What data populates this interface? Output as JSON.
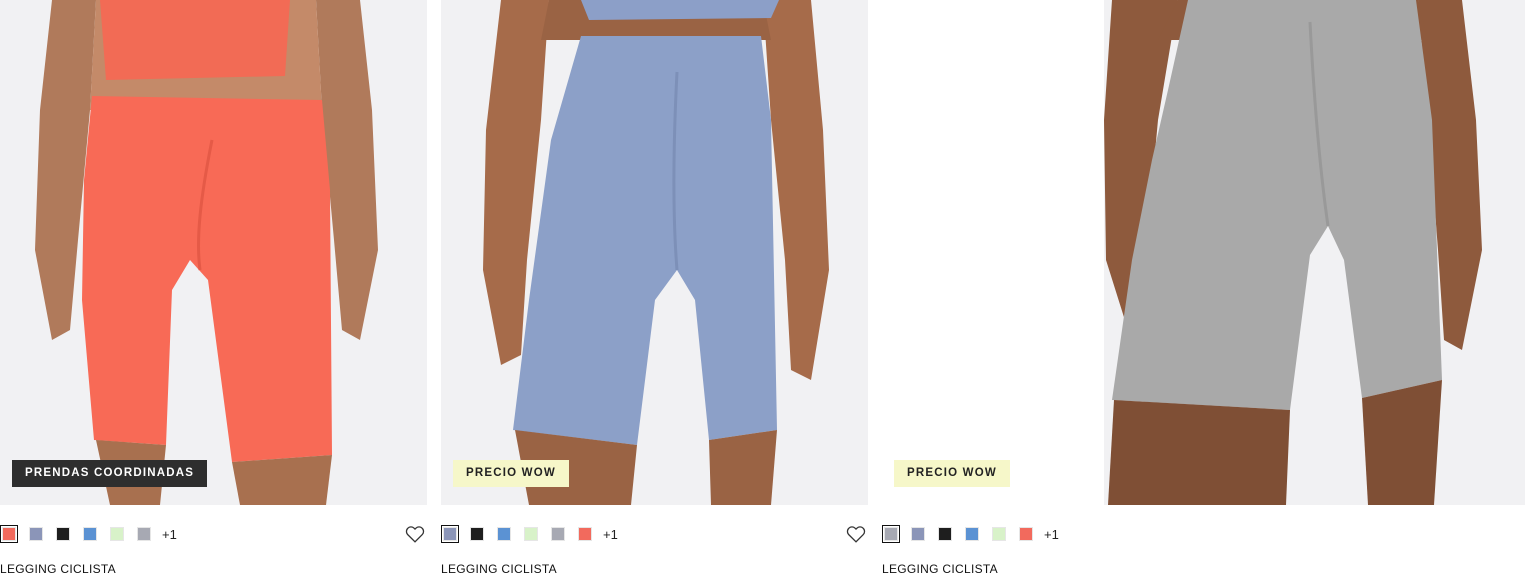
{
  "products": [
    {
      "badge": "PRENDAS COORDINADAS",
      "name": "LEGGING CICLISTA",
      "more_colors": "+1",
      "swatches": [
        "#f26a5d",
        "#8b95b8",
        "#1e1e1e",
        "#5b92d3",
        "#d8f2c9",
        "#a7a9b3"
      ],
      "selected_swatch": 0,
      "garment_color": "#f86a56"
    },
    {
      "badge": "PRECIO WOW",
      "name": "LEGGING CICLISTA",
      "more_colors": "+1",
      "swatches": [
        "#8b95b8",
        "#1e1e1e",
        "#5b92d3",
        "#d8f2c9",
        "#a7a9b3",
        "#f26a5d"
      ],
      "selected_swatch": 0,
      "garment_color": "#8c9fc8"
    },
    {
      "badge": "PRECIO WOW",
      "name": "LEGGING CICLISTA",
      "more_colors": "+1",
      "swatches": [
        "#a7a9b3",
        "#8b95b8",
        "#1e1e1e",
        "#5b92d3",
        "#d8f2c9",
        "#f26a5d"
      ],
      "selected_swatch": 0,
      "garment_color": "#a7a7a7"
    }
  ],
  "icons": {
    "wishlist": "heart-outline-icon"
  }
}
